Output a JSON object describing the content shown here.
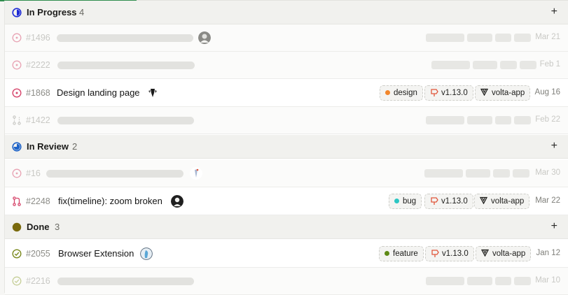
{
  "colors": {
    "in_progress": "#1e2bd6",
    "in_review": "#1e63c8",
    "done": "#7a6a0d",
    "open_issue": "#d6456b",
    "done_check": "#7b8a1f",
    "design_dot": "#f2862b",
    "bug_dot": "#2bc6c3",
    "feature_dot": "#5e8a16",
    "milestone": "#e0563b"
  },
  "groups": [
    {
      "name": "In Progress",
      "count": "4",
      "add": "+"
    },
    {
      "name": "In Review",
      "count": "2",
      "add": "+"
    },
    {
      "name": "Done",
      "count": "3",
      "add": "+"
    }
  ],
  "rows": [
    {
      "id": "#1496",
      "title": "",
      "date": "Mar 21"
    },
    {
      "id": "#2222",
      "title": "",
      "date": "Feb 1"
    },
    {
      "id": "#1868",
      "title": "Design landing page",
      "label": "design",
      "milestone": "v1.13.0",
      "project": "volta-app",
      "date": "Aug 16"
    },
    {
      "id": "#1422",
      "title": "",
      "date": "Feb 22"
    },
    {
      "id": "#16",
      "title": "",
      "date": "Mar 30"
    },
    {
      "id": "#2248",
      "title": "fix(timeline): zoom broken",
      "label": "bug",
      "milestone": "v1.13.0",
      "project": "volta-app",
      "date": "Mar 22"
    },
    {
      "id": "#2055",
      "title": "Browser Extension",
      "label": "feature",
      "milestone": "v1.13.0",
      "project": "volta-app",
      "date": "Jan 12"
    },
    {
      "id": "#2216",
      "title": "",
      "date": "Mar 10"
    }
  ]
}
